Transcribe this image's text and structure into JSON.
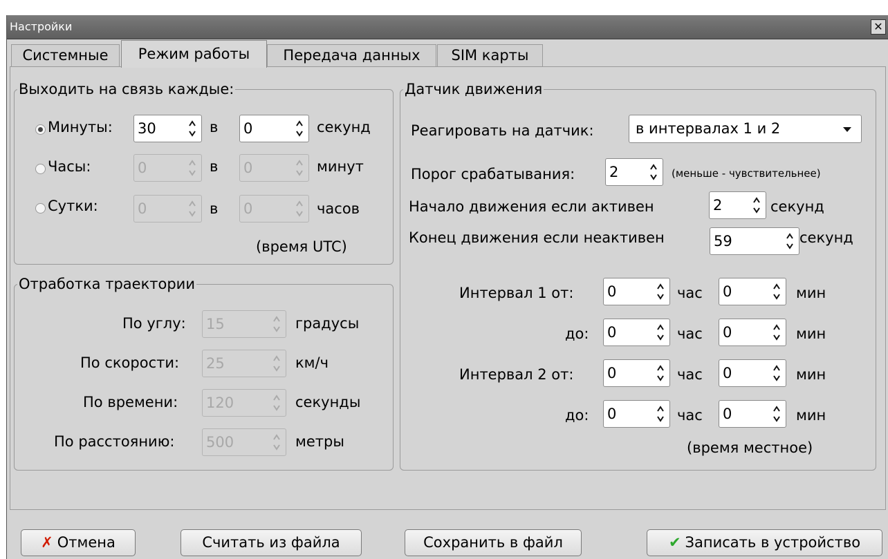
{
  "window": {
    "title": "Настройки",
    "close_glyph": "✕"
  },
  "tabs": [
    {
      "label": "Системные"
    },
    {
      "label": "Режим работы"
    },
    {
      "label": "Передача данных"
    },
    {
      "label": "SIM карты"
    }
  ],
  "active_tab": "Режим работы",
  "connect_group": {
    "legend": "Выходить на связь каждые:",
    "rows": [
      {
        "label": "Минуты:",
        "value": "30",
        "sep": "в",
        "value2": "0",
        "unit": "секунд",
        "selected": true
      },
      {
        "label": "Часы:",
        "value": "0",
        "sep": "в",
        "value2": "0",
        "unit": "минут",
        "selected": false
      },
      {
        "label": "Сутки:",
        "value": "0",
        "sep": "в",
        "value2": "0",
        "unit": "часов",
        "selected": false
      }
    ],
    "note": "(время UTC)"
  },
  "trajectory_group": {
    "legend": "Отработка траектории",
    "rows": [
      {
        "label": "По углу:",
        "value": "15",
        "unit": "градусы"
      },
      {
        "label": "По скорости:",
        "value": "25",
        "unit": "км/ч"
      },
      {
        "label": "По времени:",
        "value": "120",
        "unit": "секунды"
      },
      {
        "label": "По расстоянию:",
        "value": "500",
        "unit": "метры"
      }
    ]
  },
  "motion_group": {
    "legend": "Датчик движения",
    "react_label": "Реагировать на датчик:",
    "react_value": "в интервалах 1 и 2",
    "threshold_label": "Порог срабатывания:",
    "threshold_value": "2",
    "threshold_hint": "(меньше - чувствительнее)",
    "start_label": "Начало движения  если активен",
    "start_value": "2",
    "start_unit": "секунд",
    "end_label": "Конец движения  если неактивен",
    "end_value": "59",
    "end_unit": "секунд",
    "intervals": [
      {
        "label": "Интервал 1 от:",
        "hour": "0",
        "hour_unit": "час",
        "min": "0",
        "min_unit": "мин"
      },
      {
        "label": "до:",
        "hour": "0",
        "hour_unit": "час",
        "min": "0",
        "min_unit": "мин"
      },
      {
        "label": "Интервал 2 от:",
        "hour": "0",
        "hour_unit": "час",
        "min": "0",
        "min_unit": "мин"
      },
      {
        "label": "до:",
        "hour": "0",
        "hour_unit": "час",
        "min": "0",
        "min_unit": "мин"
      }
    ],
    "note": "(время местное)"
  },
  "buttons": {
    "cancel": "Отмена",
    "load": "Считать из файла",
    "save": "Сохранить в файл",
    "write": "Записать в устройство"
  },
  "colors": {
    "cancel_icon": "#d11a00",
    "ok_icon": "#2ea82e",
    "titlebar": "#6a6a6a"
  }
}
